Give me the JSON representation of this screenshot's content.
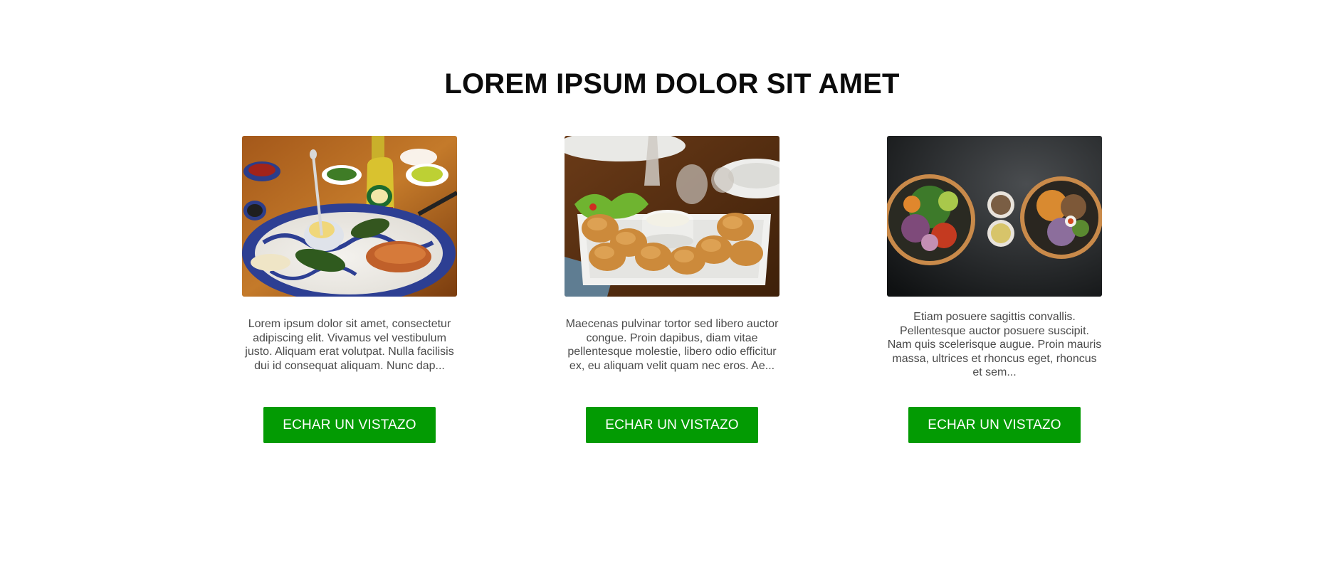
{
  "section": {
    "title": "LOREM IPSUM DOLOR SIT AMET"
  },
  "cards": [
    {
      "image": "mexican-dish-photo",
      "description": "Lorem ipsum dolor sit amet, consectetur adipiscing elit. Vivamus vel vestibulum justo. Aliquam erat volutpat. Nulla facilisis dui id consequat aliquam. Nunc dap...",
      "button_label": "ECHAR UN VISTAZO"
    },
    {
      "image": "fried-shrimp-photo",
      "description": "Maecenas pulvinar tortor sed libero auctor congue. Proin dapibus, diam vitae pellentesque molestie, libero odio efficitur ex, eu aliquam velit quam nec eros. Ae...",
      "button_label": "ECHAR UN VISTAZO"
    },
    {
      "image": "salad-bowls-photo",
      "description": "Etiam posuere sagittis convallis. Pellentesque auctor posuere suscipit. Nam quis scelerisque augue. Proin mauris massa, ultrices et rhoncus eget, rhoncus et sem...",
      "button_label": "ECHAR UN VISTAZO"
    }
  ],
  "colors": {
    "button": "#039b03",
    "title": "#0b0b0b",
    "text": "#4a4a4a"
  }
}
